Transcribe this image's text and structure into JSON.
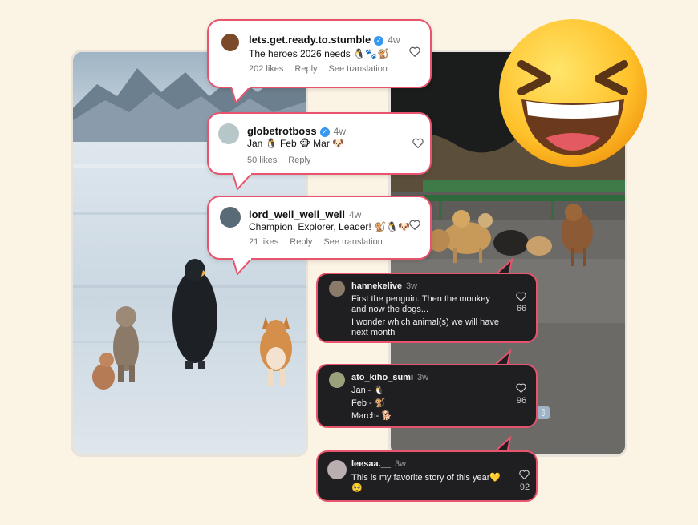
{
  "colors": {
    "background": "#fbf3e3",
    "bubble_border": "#e8546e",
    "dark_bubble": "#1f1f22",
    "verified": "#3897f0"
  },
  "light_comments": [
    {
      "username": "lets.get.ready.to.stumble",
      "verified": true,
      "time": "4w",
      "text": "The heroes 2026 needs 🐧🐾🐒",
      "likes": "202 likes",
      "reply": "Reply",
      "translation": "See translation"
    },
    {
      "username": "globetrotboss",
      "verified": true,
      "time": "4w",
      "text": "Jan 🐧 Feb 🐵 Mar 🐶",
      "likes": "50 likes",
      "reply": "Reply"
    },
    {
      "username": "lord_well_well_well",
      "verified": false,
      "time": "4w",
      "text": "Champion, Explorer, Leader! 🐒🐧🐶",
      "likes": "21 likes",
      "reply": "Reply",
      "translation": "See translation"
    }
  ],
  "dark_comments": [
    {
      "username": "hannekelive",
      "time": "3w",
      "lines": [
        "First the penguin.  Then the monkey",
        "and now the dogs...",
        "I wonder which animal(s) we will have",
        "next month"
      ],
      "likes": "66"
    },
    {
      "username": "ato_kiho_sumi",
      "time": "3w",
      "lines": [
        "Jan - 🐧",
        "Feb - 🐒",
        "March- 🐕"
      ],
      "likes": "96"
    },
    {
      "username": "leesaa.__",
      "time": "3w",
      "lines": [
        "This is my favorite story of this year💛",
        "🥺"
      ],
      "likes": "92"
    }
  ],
  "emoji": {
    "name": "laughing-squinting-face-emoji"
  },
  "icons": {
    "heart": "heart-icon",
    "download": "download-arrow-icon"
  }
}
